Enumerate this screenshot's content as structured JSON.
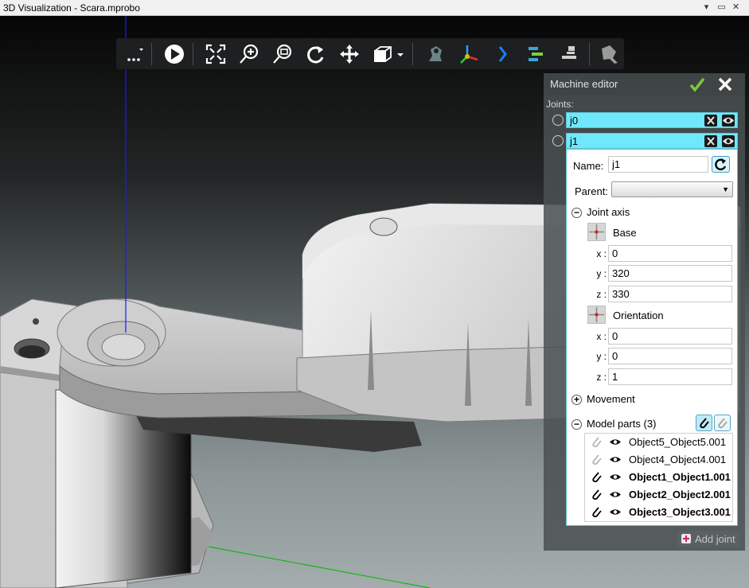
{
  "window": {
    "title": "3D Visualization - Scara.mprobo",
    "controls": [
      "▾",
      "▭",
      "✕"
    ]
  },
  "toolbar": {
    "icons": [
      "more-icon",
      "play-icon",
      "zoom-fit-icon",
      "zoom-in-icon",
      "zoom-window-icon",
      "rotate-icon",
      "pan-icon",
      "view-cube-icon",
      "view-dropdown-icon",
      "robot-arm-icon",
      "coordinate-frame-icon",
      "chevron-right-icon",
      "align-icon",
      "stack-icon",
      "tool-icon"
    ]
  },
  "editor": {
    "title": "Machine editor",
    "joints_label": "Joints:",
    "joints": [
      {
        "name": "j0"
      },
      {
        "name": "j1"
      }
    ],
    "name_label": "Name:",
    "name_value": "j1",
    "parent_label": "Parent:",
    "parent_value": "",
    "joint_axis_toggle": "−",
    "joint_axis_label": "Joint axis",
    "base_label": "Base",
    "base": {
      "x_label": "x :",
      "x": "0",
      "y_label": "y :",
      "y": "320",
      "z_label": "z :",
      "z": "330"
    },
    "orientation_label": "Orientation",
    "orientation": {
      "x_label": "x :",
      "x": "0",
      "y_label": "y :",
      "y": "0",
      "z_label": "z :",
      "z": "1"
    },
    "movement_toggle": "+",
    "movement_label": "Movement",
    "parts_toggle": "−",
    "model_parts_label": "Model parts (3)",
    "model_parts": [
      {
        "name": "Object5_Object5.001",
        "linked": false
      },
      {
        "name": "Object4_Object4.001",
        "linked": false
      },
      {
        "name": "Object1_Object1.001",
        "linked": true
      },
      {
        "name": "Object2_Object2.001",
        "linked": true
      },
      {
        "name": "Object3_Object3.001",
        "linked": true
      }
    ],
    "add_joint_label": "Add joint"
  },
  "colors": {
    "joint_row_bg": "#6fe8fb",
    "accept_green": "#7cc63a",
    "viewport_axis_blue": "#1a1aff",
    "viewport_axis_green": "#13b613"
  }
}
